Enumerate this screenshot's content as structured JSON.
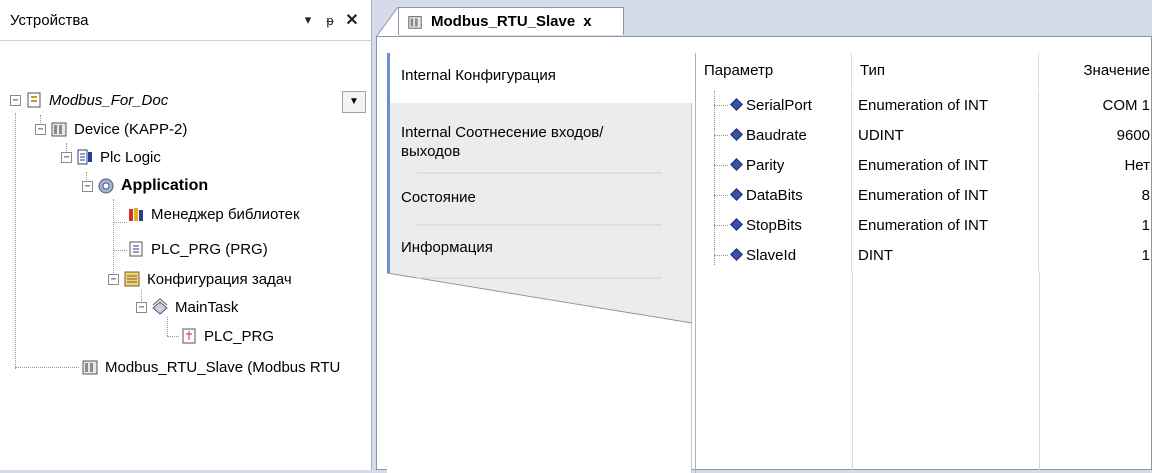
{
  "devices_panel": {
    "title": "Устройства",
    "pin_glyph": "▾",
    "dock_glyph": "ᵽ",
    "close_glyph": "✕"
  },
  "tree": {
    "root": "Modbus_For_Doc",
    "device": "Device (KAPP-2)",
    "plc_logic": "Plc Logic",
    "application": "Application",
    "library_manager": "Менеджер библиотек",
    "plc_prg": "PLC_PRG (PRG)",
    "task_config": "Конфигурация задач",
    "main_task": "MainTask",
    "main_task_prg": "PLC_PRG",
    "modbus_slave": "Modbus_RTU_Slave (Modbus RTU"
  },
  "editor": {
    "tab_title": "Modbus_RTU_Slave",
    "tab_close": "x"
  },
  "side_tabs": [
    {
      "label": "Internal Конфигурация"
    },
    {
      "label": "Internal Соотнесение входов/выходов"
    },
    {
      "label": "Состояние"
    },
    {
      "label": "Информация"
    }
  ],
  "param_table": {
    "headers": {
      "param": "Параметр",
      "type": "Тип",
      "value": "Значение"
    },
    "rows": [
      {
        "param": "SerialPort",
        "type": "Enumeration of INT",
        "value": "COM 1"
      },
      {
        "param": "Baudrate",
        "type": "UDINT",
        "value": "9600"
      },
      {
        "param": "Parity",
        "type": "Enumeration of INT",
        "value": "Нет"
      },
      {
        "param": "DataBits",
        "type": "Enumeration of INT",
        "value": "8"
      },
      {
        "param": "StopBits",
        "type": "Enumeration of INT",
        "value": "1"
      },
      {
        "param": "SlaveId",
        "type": "DINT",
        "value": "1"
      }
    ]
  }
}
